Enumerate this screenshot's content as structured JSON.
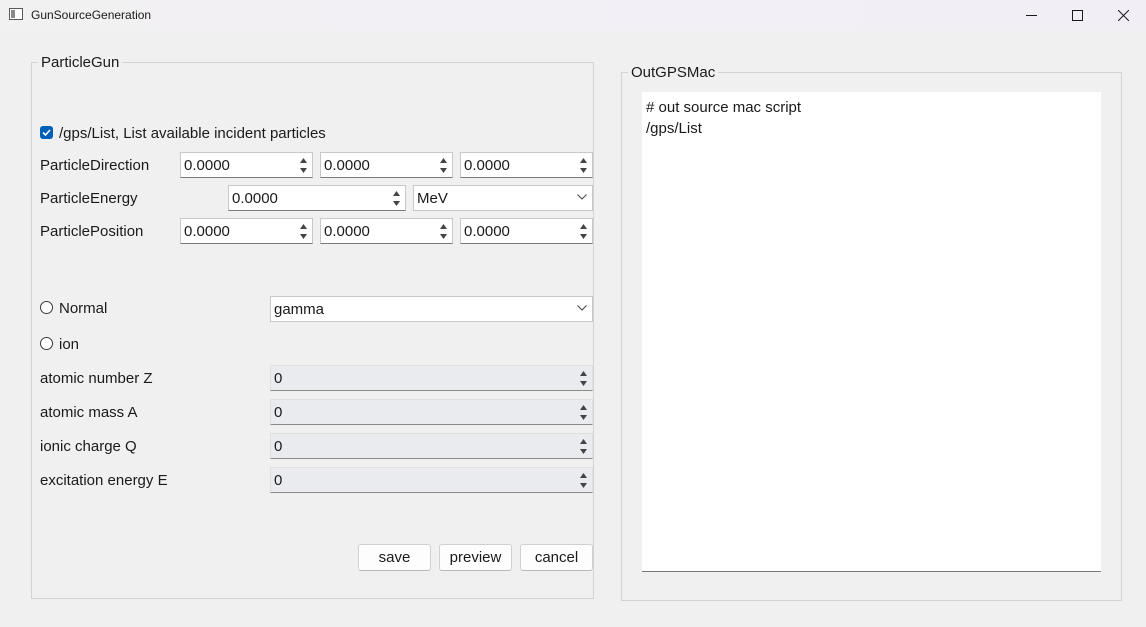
{
  "window": {
    "title": "GunSourceGeneration",
    "icons": {
      "app": "app-window-icon",
      "minimize": "minimize-icon",
      "maximize": "maximize-icon",
      "close": "close-icon"
    }
  },
  "particle_gun": {
    "group_title": "ParticleGun",
    "list_checkbox": {
      "label": "/gps/List, List available incident particles",
      "checked": true
    },
    "direction": {
      "label": "ParticleDirection",
      "x": "0.0000",
      "y": "0.0000",
      "z": "0.0000"
    },
    "energy": {
      "label": "ParticleEnergy",
      "value": "0.0000",
      "unit": "MeV"
    },
    "position": {
      "label": "ParticlePosition",
      "x": "0.0000",
      "y": "0.0000",
      "z": "0.0000"
    },
    "normal_radio": {
      "label": "Normal",
      "checked": false
    },
    "particle_select": {
      "value": "gamma"
    },
    "ion_radio": {
      "label": "ion",
      "checked": false
    },
    "atomic_number": {
      "label": "atomic number Z",
      "value": "0"
    },
    "atomic_mass": {
      "label": "atomic mass A",
      "value": "0"
    },
    "ionic_charge": {
      "label": "ionic charge Q",
      "value": "0"
    },
    "excitation_energy": {
      "label": "excitation energy E",
      "value": "0"
    },
    "buttons": {
      "save": "save",
      "preview": "preview",
      "cancel": "cancel"
    }
  },
  "out_gps_mac": {
    "group_title": "OutGPSMac",
    "lines": [
      "# out source mac script",
      "/gps/List"
    ]
  },
  "colors": {
    "accent": "#005fb8",
    "background": "#f0f0f0",
    "disabled_field": "#e9ebee"
  }
}
